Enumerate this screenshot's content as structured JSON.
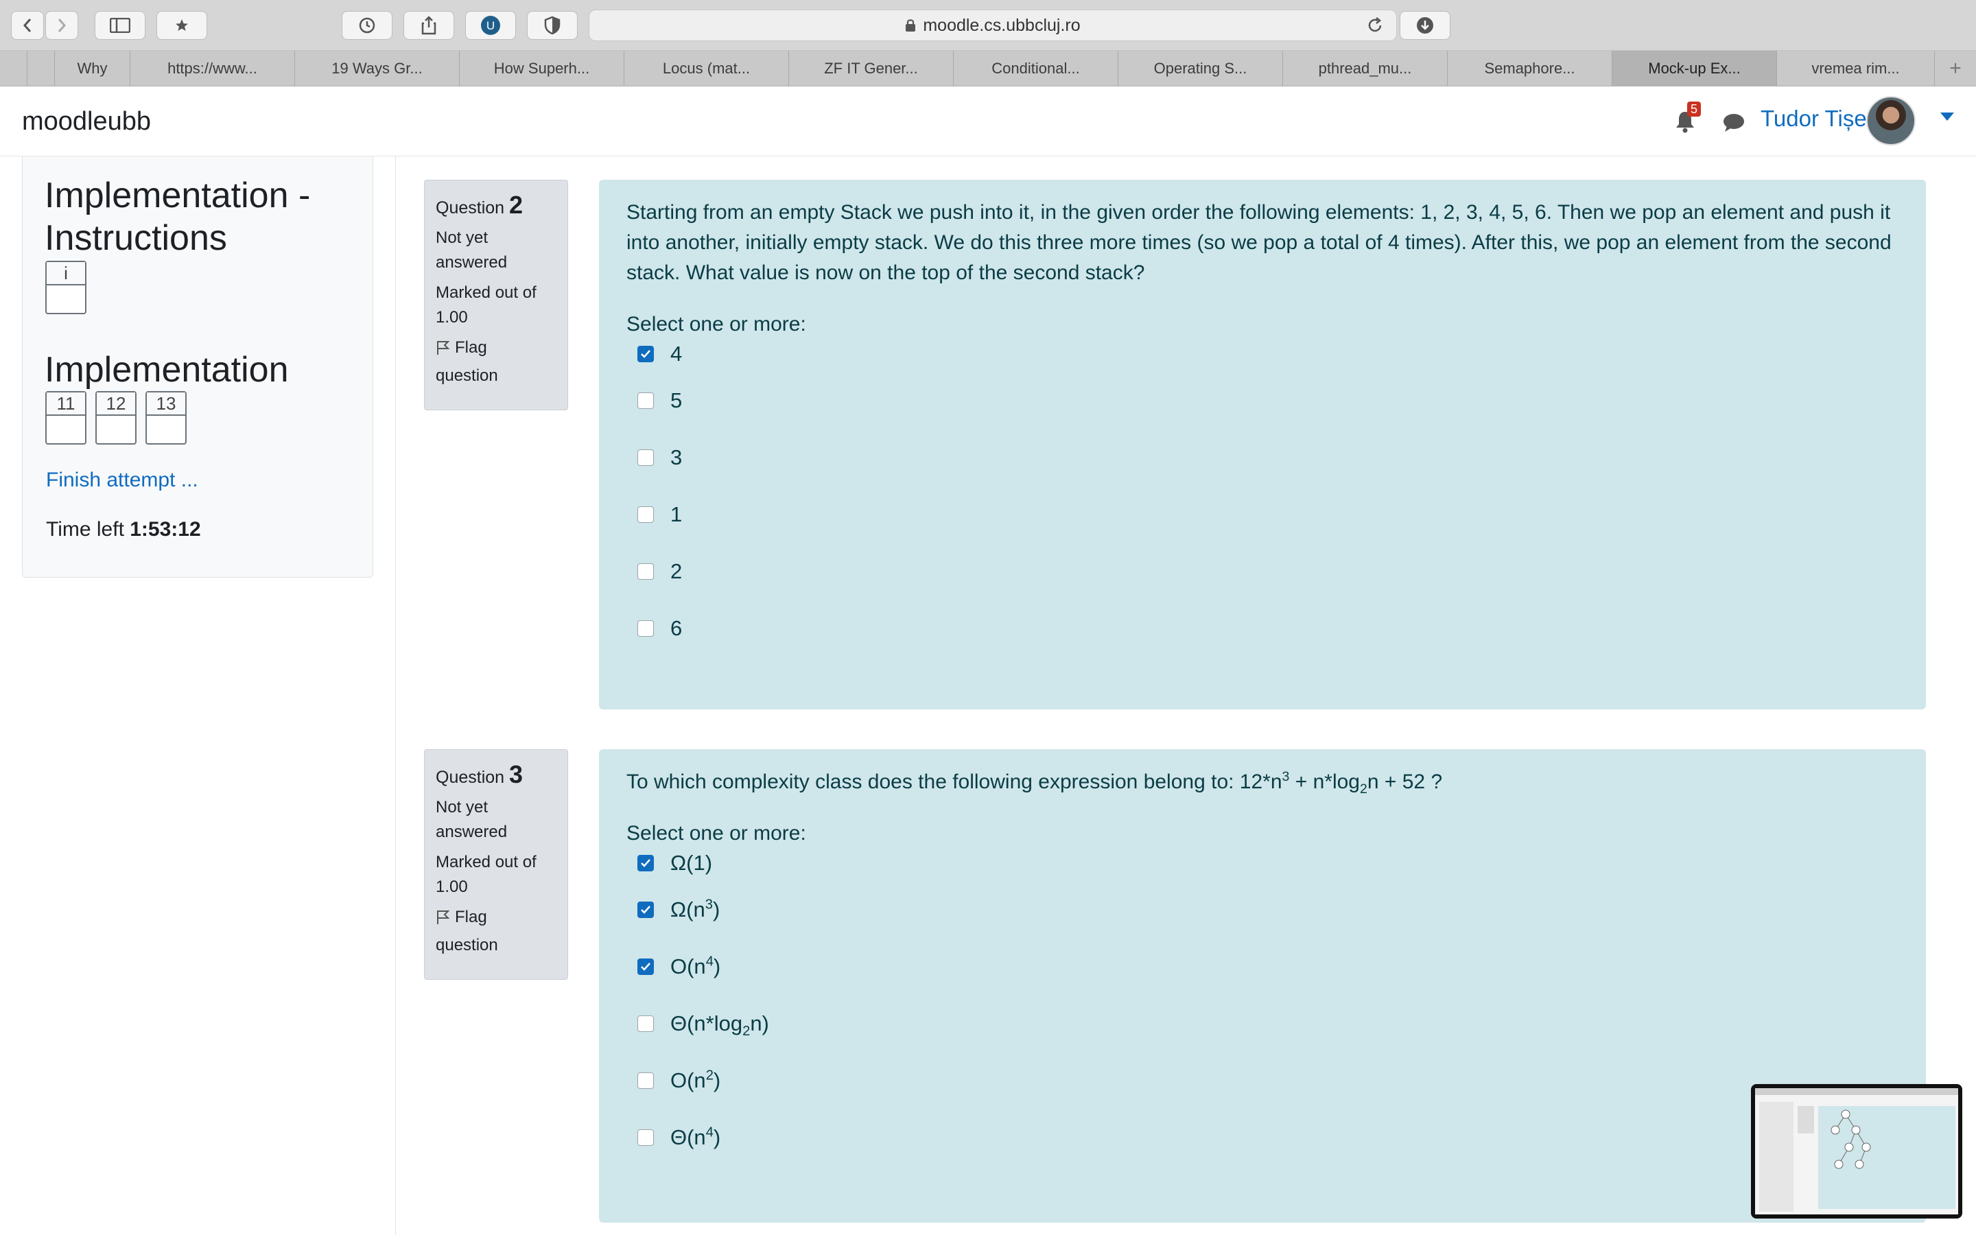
{
  "browser": {
    "url": "moodle.cs.ubbcluj.ro",
    "tabs": [
      {
        "label": ""
      },
      {
        "label": ""
      },
      {
        "label": "Why"
      },
      {
        "label": "https://www..."
      },
      {
        "label": "19 Ways Gr..."
      },
      {
        "label": "How Superh..."
      },
      {
        "label": "Locus (mat..."
      },
      {
        "label": "ZF IT Gener..."
      },
      {
        "label": "Conditional..."
      },
      {
        "label": "Operating S..."
      },
      {
        "label": "pthread_mu..."
      },
      {
        "label": "Semaphore..."
      },
      {
        "label": "Mock-up Ex..."
      },
      {
        "label": "vremea rim..."
      }
    ]
  },
  "navbar": {
    "brand": "moodleubb",
    "notification_count": "5",
    "user_name": "Tudor Tișe"
  },
  "quiz_nav": {
    "section1_title_line1": "Implementation -",
    "section1_title_line2": "Instructions",
    "section1_buttons": [
      "i"
    ],
    "section2_title": "Implementation",
    "section2_buttons": [
      "11",
      "12",
      "13"
    ],
    "finish_label": "Finish attempt ...",
    "time_left_label": "Time left",
    "time_left_value": "1:53:12"
  },
  "questions": [
    {
      "label": "Question",
      "number": "2",
      "status_line1": "Not yet",
      "status_line2": "answered",
      "marks_line1": "Marked out of",
      "marks_line2": "1.00",
      "flag_line1": "Flag",
      "flag_line2": "question",
      "text": "Starting from an empty Stack we push into it, in the given order the following elements: 1, 2, 3, 4, 5, 6. Then we pop an element and push it into another, initially empty stack. We do this three more times (so we pop a total of 4 times). After this, we pop an element from the second stack. What value is now on the top of the second stack?",
      "prompt": "Select one or more:",
      "options": [
        {
          "label": "4",
          "checked": true
        },
        {
          "label": "5",
          "checked": false
        },
        {
          "label": "3",
          "checked": false
        },
        {
          "label": "1",
          "checked": false
        },
        {
          "label": "2",
          "checked": false
        },
        {
          "label": "6",
          "checked": false
        }
      ]
    },
    {
      "label": "Question",
      "number": "3",
      "status_line1": "Not yet",
      "status_line2": "answered",
      "marks_line1": "Marked out of",
      "marks_line2": "1.00",
      "flag_line1": "Flag",
      "flag_line2": "question",
      "text_html": "To which complexity class does the following expression belong to: 12*n<sup>3</sup> + n*log<sub>2</sub>n + 52 ?",
      "prompt": "Select one or more:",
      "options": [
        {
          "label_html": "Ω(1)",
          "checked": true
        },
        {
          "label_html": "Ω(n<sup>3</sup>)",
          "checked": true
        },
        {
          "label_html": "O(n<sup>4</sup>)",
          "checked": true
        },
        {
          "label_html": "Θ(n*log<sub>2</sub>n)",
          "checked": false
        },
        {
          "label_html": "O(n<sup>2</sup>)",
          "checked": false
        },
        {
          "label_html": "Θ(n<sup>4</sup>)",
          "checked": false
        }
      ]
    }
  ],
  "colors": {
    "link": "#0f6cbf",
    "question_bg": "#cfe6ea",
    "info_bg": "#dee2e6",
    "badge": "#ca3120"
  }
}
